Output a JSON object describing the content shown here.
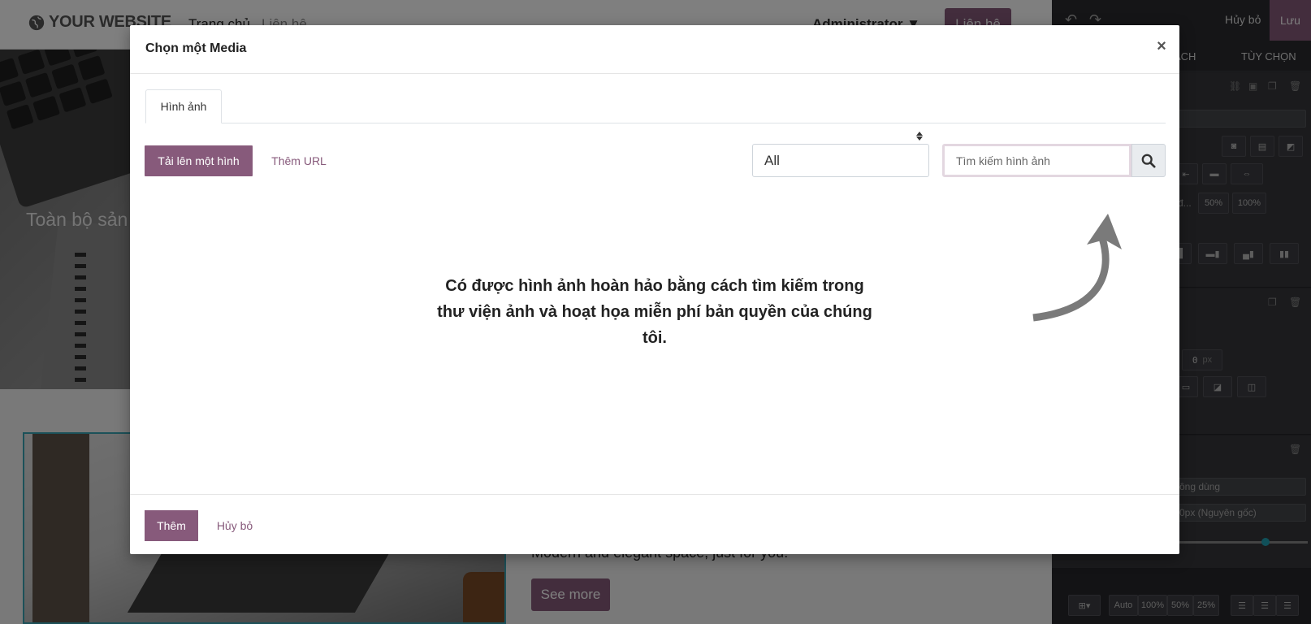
{
  "site": {
    "logo_text": "YOUR WEBSITE",
    "nav_home": "Trang chủ",
    "nav_contact": "Liên hệ",
    "nav_user": "Administrator ▼",
    "nav_button": "Liên hệ",
    "hero_text": "Toàn bộ sản p",
    "section_text": "Modern and elegant space, just for you!",
    "section_button": "See more"
  },
  "editor": {
    "discard": "Hủy bỏ",
    "save": "Lưu",
    "tab_style": "ÁCH",
    "tab_options": "TÙY CHỌN",
    "size_50": "50%",
    "size_100": "100%",
    "size_label": "đ...",
    "zero_value": "0",
    "px_unit": "px",
    "dd_usage": "ông dùng",
    "dd_original": "0px (Nguyên gốc)",
    "bottom_auto": "Auto",
    "bottom_100": "100%",
    "bottom_50": "50%",
    "bottom_25": "25%"
  },
  "modal": {
    "title": "Chọn một Media",
    "close": "×",
    "tab_images": "Hình ảnh",
    "upload_button": "Tải lên một hình",
    "url_button": "Thêm URL",
    "filter_selected": "All",
    "search_placeholder": "Tìm kiếm hình ảnh",
    "empty_message": "Có được hình ảnh hoàn hảo bằng cách tìm kiếm trong thư viện ảnh và hoạt họa miễn phí bản quyền của chúng tôi.",
    "add_button": "Thêm",
    "cancel_button": "Hủy bỏ"
  },
  "colors": {
    "primary": "#875a7b",
    "accent": "#20a1b3"
  }
}
